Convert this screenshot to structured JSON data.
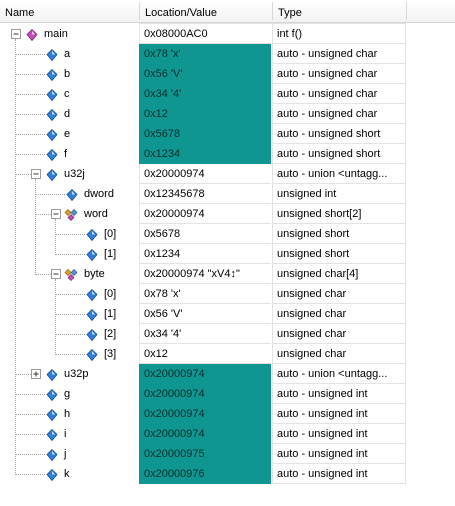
{
  "columns": {
    "name": "Name",
    "value": "Location/Value",
    "type": "Type"
  },
  "colors": {
    "highlight": "#0f9690",
    "grid": "#e3e3e3"
  },
  "rows": [
    {
      "name": "main",
      "value": "0x08000AC0",
      "type": "int f()",
      "level": 0,
      "expander": "minus",
      "icon": "function-icon",
      "highlight": false
    },
    {
      "name": "a",
      "value": "0x78 'x'",
      "type": "auto - unsigned char",
      "level": 1,
      "expander": "",
      "icon": "variable-icon",
      "highlight": true
    },
    {
      "name": "b",
      "value": "0x56 'V'",
      "type": "auto - unsigned char",
      "level": 1,
      "expander": "",
      "icon": "variable-icon",
      "highlight": true
    },
    {
      "name": "c",
      "value": "0x34 '4'",
      "type": "auto - unsigned char",
      "level": 1,
      "expander": "",
      "icon": "variable-icon",
      "highlight": true
    },
    {
      "name": "d",
      "value": "0x12",
      "type": "auto - unsigned char",
      "level": 1,
      "expander": "",
      "icon": "variable-icon",
      "highlight": true
    },
    {
      "name": "e",
      "value": "0x5678",
      "type": "auto - unsigned short",
      "level": 1,
      "expander": "",
      "icon": "variable-icon",
      "highlight": true
    },
    {
      "name": "f",
      "value": "0x1234",
      "type": "auto - unsigned short",
      "level": 1,
      "expander": "",
      "icon": "variable-icon",
      "highlight": true
    },
    {
      "name": "u32j",
      "value": "0x20000974",
      "type": "auto - union <untagg...",
      "level": 1,
      "expander": "minus",
      "icon": "variable-icon",
      "highlight": false
    },
    {
      "name": "dword",
      "value": "0x12345678",
      "type": "unsigned int",
      "level": 2,
      "expander": "",
      "icon": "variable-icon",
      "highlight": false
    },
    {
      "name": "word",
      "value": "0x20000974",
      "type": "unsigned short[2]",
      "level": 2,
      "expander": "minus",
      "icon": "array-icon",
      "highlight": false
    },
    {
      "name": "[0]",
      "value": "0x5678",
      "type": "unsigned short",
      "level": 3,
      "expander": "",
      "icon": "variable-icon",
      "highlight": false
    },
    {
      "name": "[1]",
      "value": "0x1234",
      "type": "unsigned short",
      "level": 3,
      "expander": "",
      "icon": "variable-icon",
      "highlight": false
    },
    {
      "name": "byte",
      "value": "0x20000974 \"xV4↕\"",
      "type": "unsigned char[4]",
      "level": 2,
      "expander": "minus",
      "icon": "array-icon",
      "highlight": false
    },
    {
      "name": "[0]",
      "value": "0x78 'x'",
      "type": "unsigned char",
      "level": 3,
      "expander": "",
      "icon": "variable-icon",
      "highlight": false
    },
    {
      "name": "[1]",
      "value": "0x56 'V'",
      "type": "unsigned char",
      "level": 3,
      "expander": "",
      "icon": "variable-icon",
      "highlight": false
    },
    {
      "name": "[2]",
      "value": "0x34 '4'",
      "type": "unsigned char",
      "level": 3,
      "expander": "",
      "icon": "variable-icon",
      "highlight": false
    },
    {
      "name": "[3]",
      "value": "0x12",
      "type": "unsigned char",
      "level": 3,
      "expander": "",
      "icon": "variable-icon",
      "highlight": false
    },
    {
      "name": "u32p",
      "value": "0x20000974",
      "type": "auto - union <untagg...",
      "level": 1,
      "expander": "plus",
      "icon": "variable-icon",
      "highlight": true
    },
    {
      "name": "g",
      "value": "0x20000974",
      "type": "auto - unsigned int",
      "level": 1,
      "expander": "",
      "icon": "variable-icon",
      "highlight": true
    },
    {
      "name": "h",
      "value": "0x20000974",
      "type": "auto - unsigned int",
      "level": 1,
      "expander": "",
      "icon": "variable-icon",
      "highlight": true
    },
    {
      "name": "i",
      "value": "0x20000974",
      "type": "auto - unsigned int",
      "level": 1,
      "expander": "",
      "icon": "variable-icon",
      "highlight": true
    },
    {
      "name": "j",
      "value": "0x20000975",
      "type": "auto - unsigned int",
      "level": 1,
      "expander": "",
      "icon": "variable-icon",
      "highlight": true
    },
    {
      "name": "k",
      "value": "0x20000976",
      "type": "auto - unsigned int",
      "level": 1,
      "expander": "",
      "icon": "variable-icon",
      "highlight": true
    }
  ]
}
